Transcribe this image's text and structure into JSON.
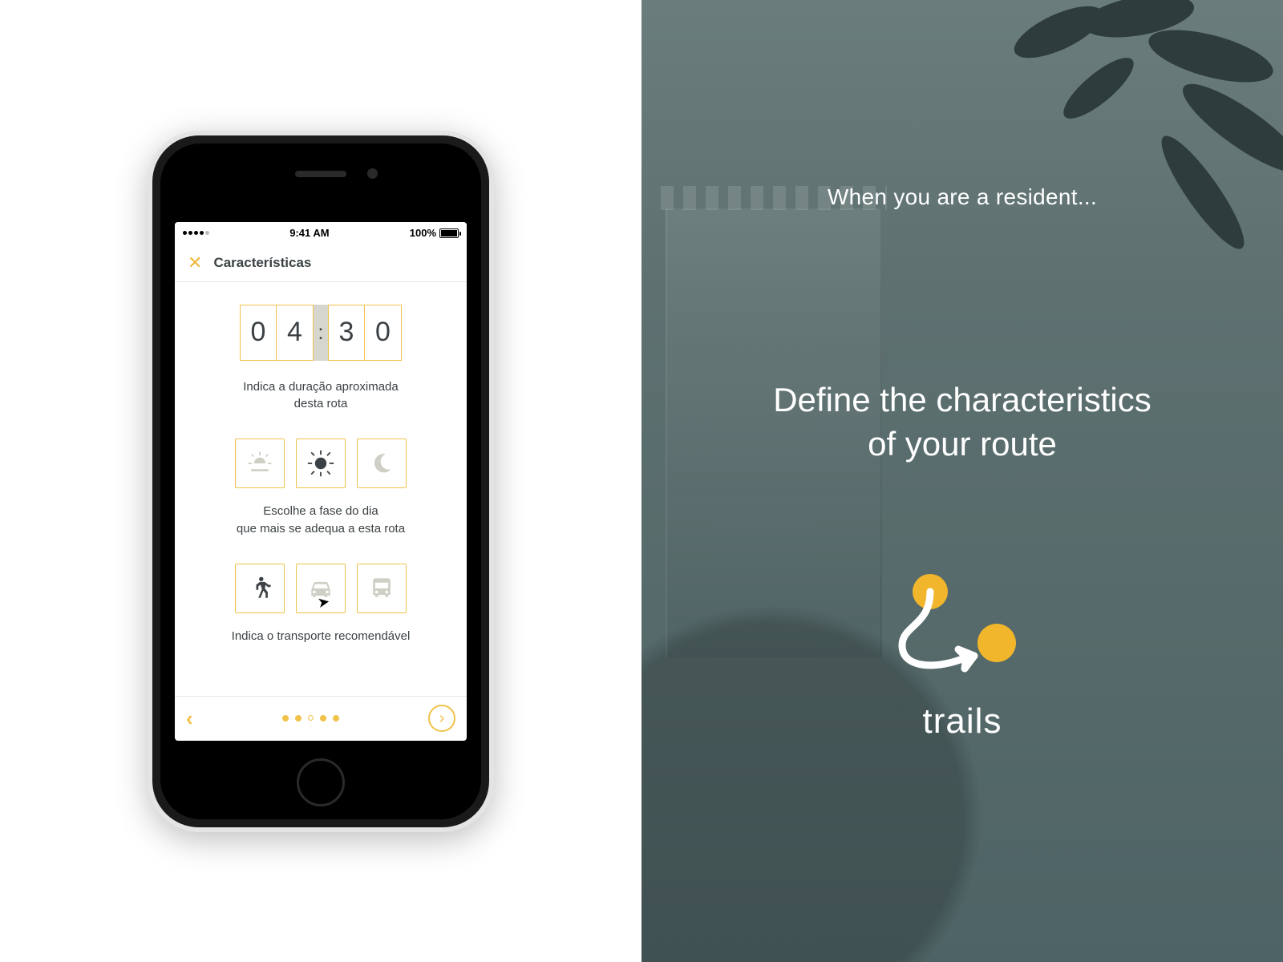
{
  "statusbar": {
    "time": "9:41 AM",
    "battery": "100%"
  },
  "header": {
    "title": "Características"
  },
  "time_digits": [
    "0",
    "4",
    "3",
    "0"
  ],
  "captions": {
    "duration_l1": "Indica a duração aproximada",
    "duration_l2": "desta rota",
    "phase_l1": "Escolhe a fase do dia",
    "phase_l2": "que mais se adequa a esta rota",
    "transport": "Indica o transporte recomendável"
  },
  "phase_options": [
    {
      "name": "sunrise-icon",
      "selected": false
    },
    {
      "name": "sun-icon",
      "selected": true
    },
    {
      "name": "moon-icon",
      "selected": false
    }
  ],
  "transport_options": [
    {
      "name": "walk-icon",
      "selected": true
    },
    {
      "name": "car-icon",
      "selected": false
    },
    {
      "name": "bus-icon",
      "selected": false
    }
  ],
  "pager": {
    "total": 5,
    "current_index": 2
  },
  "promo": {
    "subhead": "When you are a resident...",
    "headline_l1": "Define the characteristics",
    "headline_l2": "of your route",
    "brand": "trails"
  },
  "colors": {
    "accent": "#f0c24a",
    "brandYellow": "#f1b62b",
    "panel": "#5e7070"
  }
}
